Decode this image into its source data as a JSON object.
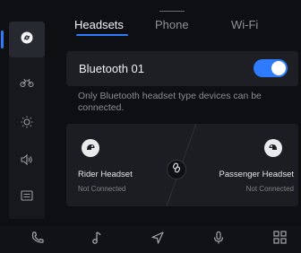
{
  "tabs": [
    {
      "label": "Headsets",
      "active": true
    },
    {
      "label": "Phone",
      "active": false
    },
    {
      "label": "Wi-Fi",
      "active": false
    }
  ],
  "sidebar": {
    "items": [
      {
        "icon": "headset-connect-icon",
        "active": true
      },
      {
        "icon": "motorcycle-icon",
        "active": false
      },
      {
        "icon": "brightness-icon",
        "active": false
      },
      {
        "icon": "volume-icon",
        "active": false
      },
      {
        "icon": "message-icon",
        "active": false
      }
    ]
  },
  "bluetooth": {
    "name": "Bluetooth 01",
    "enabled": true,
    "info": "Only Bluetooth headset type devices can be connected."
  },
  "headsets": {
    "rider": {
      "label": "Rider Headset",
      "status": "Not Connected"
    },
    "passenger": {
      "label": "Passenger Headset",
      "status": "Not Connected"
    }
  },
  "bottom_nav": [
    "phone-icon",
    "music-icon",
    "navigation-icon",
    "microphone-icon",
    "apps-grid-icon"
  ],
  "colors": {
    "accent": "#2f7bff",
    "background": "#0e0f12",
    "card": "#1d1f24"
  }
}
